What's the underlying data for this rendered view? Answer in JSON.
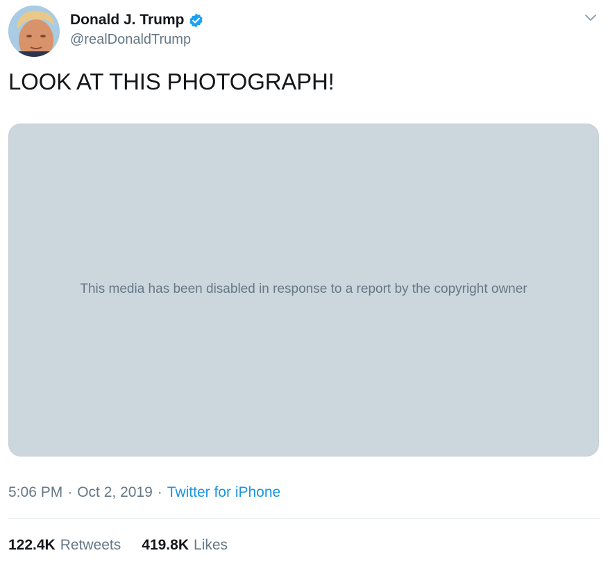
{
  "header": {
    "display_name": "Donald J. Trump",
    "handle": "@realDonaldTrump",
    "verified": true,
    "avatar_icon": "profile-photo",
    "menu_icon": "chevron-down-icon"
  },
  "tweet": {
    "text": "LOOK AT THIS PHOTOGRAPH!",
    "media_message": "This media has been disabled in response to a report by the copyright owner"
  },
  "meta": {
    "time": "5:06 PM",
    "separator": "·",
    "date": "Oct 2, 2019",
    "source": "Twitter for iPhone"
  },
  "stats": {
    "retweets_count": "122.4K",
    "retweets_label": "Retweets",
    "likes_count": "419.8K",
    "likes_label": "Likes"
  },
  "colors": {
    "accent": "#1b95e0",
    "verified_badge": "#1da1f2",
    "secondary_text": "#657786",
    "media_placeholder": "#ccd6dd"
  }
}
